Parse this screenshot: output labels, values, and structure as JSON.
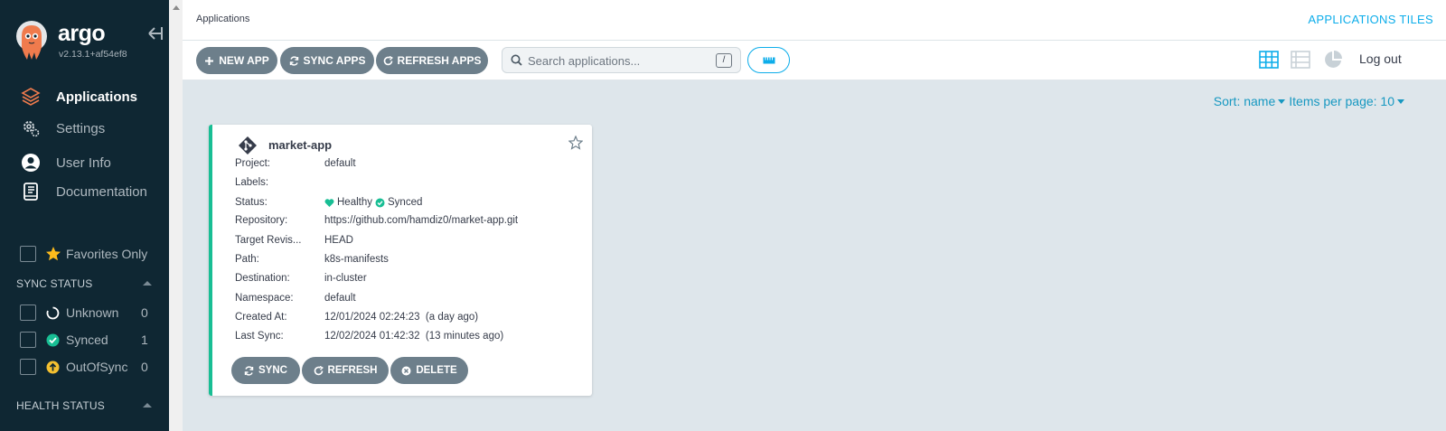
{
  "sidebar": {
    "logo_text": "argo",
    "version": "v2.13.1+af54ef8",
    "nav": [
      {
        "label": "Applications",
        "icon": "layers-icon",
        "active": true
      },
      {
        "label": "Settings",
        "icon": "gears-icon"
      },
      {
        "label": "User Info",
        "icon": "user-circle-icon"
      },
      {
        "label": "Documentation",
        "icon": "book-icon"
      }
    ],
    "favorites_label": "Favorites Only",
    "sync_status_title": "SYNC STATUS",
    "sync_filters": [
      {
        "label": "Unknown",
        "count": "0",
        "icon": "circle-notch-icon"
      },
      {
        "label": "Synced",
        "count": "1",
        "icon": "check-circle-icon"
      },
      {
        "label": "OutOfSync",
        "count": "0",
        "icon": "arrow-up-circle-icon"
      }
    ],
    "health_status_title": "HEALTH STATUS"
  },
  "header": {
    "breadcrumb": "Applications",
    "title": "APPLICATIONS TILES"
  },
  "toolbar": {
    "new_app": "NEW APP",
    "sync_apps": "SYNC APPS",
    "refresh_apps": "REFRESH APPS",
    "search_placeholder": "Search applications...",
    "search_shortcut": "/",
    "logout": "Log out"
  },
  "sort": {
    "sort_label": "Sort: name",
    "items_per_page": "Items per page: 10"
  },
  "app_card": {
    "name": "market-app",
    "fields": [
      {
        "label": "Project:",
        "value": "default"
      },
      {
        "label": "Labels:",
        "value": ""
      },
      {
        "label": "Status:",
        "health": "Healthy",
        "sync": "Synced"
      },
      {
        "label": "Repository:",
        "value": "https://github.com/hamdiz0/market-app.git"
      },
      {
        "label": "Target Revis...",
        "value": "HEAD"
      },
      {
        "label": "Path:",
        "value": "k8s-manifests"
      },
      {
        "label": "Destination:",
        "value": "in-cluster"
      },
      {
        "label": "Namespace:",
        "value": "default"
      },
      {
        "label": "Created At:",
        "value": "12/01/2024 02:24:23  (a day ago)"
      },
      {
        "label": "Last Sync:",
        "value": "12/02/2024 01:42:32  (13 minutes ago)"
      }
    ],
    "buttons": {
      "sync": "SYNC",
      "refresh": "REFRESH",
      "delete": "DELETE"
    }
  },
  "colors": {
    "sidebar_bg": "#0f2733",
    "accent": "#0dadea",
    "healthy": "#18be94",
    "out_of_sync": "#f4c030",
    "button": "#6d7f8b"
  }
}
